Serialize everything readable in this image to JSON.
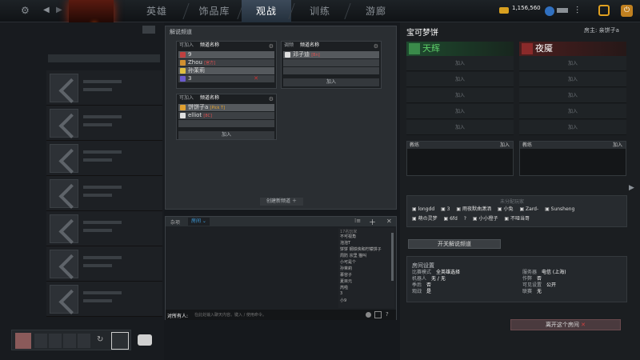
{
  "topbar": {
    "tabs": [
      "英雄",
      "饰品库",
      "观战",
      "训练",
      "游廊"
    ],
    "active_tab": "观战",
    "gold": "1,156,560"
  },
  "channels": {
    "title": "解说频道",
    "create_label": "创建新频道",
    "blocks": [
      {
        "lang": "可加入",
        "name": "频道名称",
        "players": [
          {
            "name": "9",
            "tag": "",
            "color": "#c04040"
          },
          {
            "name": "Zhou",
            "tag": "[官方]",
            "color": "#d09030"
          },
          {
            "name": "孙茉莉",
            "tag": "",
            "color": "#e0c040"
          },
          {
            "name": "3",
            "tag": "",
            "color": "#6a5acd"
          }
        ],
        "join": ""
      },
      {
        "lang": "调频",
        "name": "频道名称",
        "players": [
          {
            "name": "邓子迪",
            "tag": "[Bn]",
            "color": "#e0e0e0"
          },
          {
            "name": "",
            "tag": "",
            "color": ""
          },
          {
            "name": "",
            "tag": "",
            "color": ""
          },
          {
            "name": "",
            "tag": "",
            "color": ""
          }
        ],
        "join": "加入"
      },
      {
        "lang": "可加入",
        "name": "频道名称",
        "players": [
          {
            "name": "饼饼子a",
            "tag": "[Pick T]",
            "color": "#e0a030"
          },
          {
            "name": "elliot",
            "tag": "[8C]",
            "color": "#e0e0e0"
          }
        ],
        "join": "加入"
      }
    ]
  },
  "chat": {
    "tab1": "杂项",
    "tab2": "房间",
    "side_list": [
      "17名玩家",
      "不可视角",
      "泡泡T",
      "饼饼 钢铁侠和柠檬饼子",
      "周防 宗里 猫叫",
      "小可是个",
      "孙茉莉",
      "慕容子",
      "夏目元",
      "芮啦",
      "3",
      "小9"
    ],
    "input_label": "对所有人:",
    "input_placeholder": "在此处输入聊天内容。键入 / 使用命令。"
  },
  "lobby": {
    "title": "宝可梦饼",
    "host_label": "房主: 亲饼子a",
    "radiant": "天辉",
    "dire": "夜魇",
    "slot_label": "加入",
    "coach_label": "教练",
    "coach_join": "加入",
    "unassigned_title": "未分配玩家",
    "unassigned": [
      "longdd",
      "3",
      "雨夜默曲潇洒",
      "小兔",
      "Zard-",
      "Sunsheng",
      "萌の灵梦",
      "6fd",
      "?",
      "小小橙子",
      "不哑当哥"
    ],
    "broadcast_btn": "开关解说频道",
    "settings_title": "房间设置",
    "settings": [
      {
        "k": "比赛模式",
        "v": "全英雄选择"
      },
      {
        "k": "机器人",
        "v": "无 / 无"
      },
      {
        "k": "季后",
        "v": "否"
      },
      {
        "k": "观战",
        "v": "是"
      },
      {
        "k": "服务器",
        "v": "电信 (上海)"
      },
      {
        "k": "作弊",
        "v": "否"
      },
      {
        "k": "可见设置",
        "v": "公开"
      },
      {
        "k": "联赛",
        "v": "无"
      }
    ],
    "leave_btn": "离开这个房间"
  }
}
